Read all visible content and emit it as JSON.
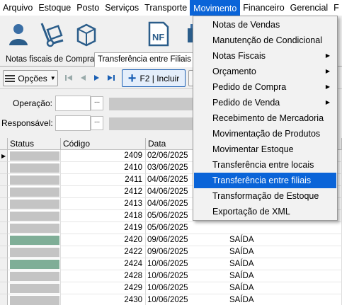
{
  "menubar": {
    "items": [
      "Arquivo",
      "Estoque",
      "Posto",
      "Serviços",
      "Transporte",
      "Movimento",
      "Financeiro",
      "Gerencial",
      "F"
    ],
    "active": "Movimento"
  },
  "tabs": [
    "Notas fiscais de Compras",
    "Transferência entre Filiais"
  ],
  "toolbar": {
    "options_label": "Opções",
    "include_label": "F2 | Incluir"
  },
  "filters": {
    "operation_label": "Operação:",
    "responsible_label": "Responsável:",
    "ellipsis": "..."
  },
  "grid": {
    "columns": [
      "Status",
      "Código",
      "Data"
    ],
    "rows": [
      {
        "code": "2409",
        "date": "02/06/2025",
        "status": "gray",
        "extra": ""
      },
      {
        "code": "2410",
        "date": "03/06/2025",
        "status": "gray",
        "extra": ""
      },
      {
        "code": "2411",
        "date": "04/06/2025",
        "status": "gray",
        "extra": ""
      },
      {
        "code": "2412",
        "date": "04/06/2025",
        "status": "gray",
        "extra": ""
      },
      {
        "code": "2413",
        "date": "04/06/2025",
        "status": "gray",
        "extra": ""
      },
      {
        "code": "2418",
        "date": "05/06/2025",
        "status": "gray",
        "extra": ""
      },
      {
        "code": "2419",
        "date": "05/06/2025",
        "status": "gray",
        "extra": ""
      },
      {
        "code": "2420",
        "date": "09/06/2025",
        "status": "green",
        "extra": "SAÍDA"
      },
      {
        "code": "2422",
        "date": "09/06/2025",
        "status": "gray",
        "extra": "SAÍDA"
      },
      {
        "code": "2424",
        "date": "10/06/2025",
        "status": "green",
        "extra": "SAÍDA"
      },
      {
        "code": "2428",
        "date": "10/06/2025",
        "status": "gray",
        "extra": "SAÍDA"
      },
      {
        "code": "2429",
        "date": "10/06/2025",
        "status": "gray",
        "extra": "SAÍDA"
      },
      {
        "code": "2430",
        "date": "10/06/2025",
        "status": "gray",
        "extra": "SAÍDA"
      }
    ]
  },
  "dropdown": {
    "items": [
      {
        "label": "Notas de Vendas",
        "submenu": false
      },
      {
        "label": "Manutenção de Condicional",
        "submenu": false
      },
      {
        "label": "Notas Fiscais",
        "submenu": true
      },
      {
        "label": "Orçamento",
        "submenu": true
      },
      {
        "label": "Pedido de Compra",
        "submenu": true
      },
      {
        "label": "Pedido de Venda",
        "submenu": true
      },
      {
        "label": "Recebimento de Mercadoria",
        "submenu": false
      },
      {
        "label": "Movimentação de Produtos",
        "submenu": false
      },
      {
        "label": "Movimentar Estoque",
        "submenu": false
      },
      {
        "label": "Transferência entre locais",
        "submenu": false
      },
      {
        "label": "Transferência entre filiais",
        "submenu": false
      },
      {
        "label": "Transformação de Estoque",
        "submenu": false
      },
      {
        "label": "Exportação de XML",
        "submenu": false
      }
    ],
    "highlighted": "Transferência entre filiais"
  },
  "colors": {
    "accent": "#0a64d8",
    "status_gray": "#c4c4c4",
    "status_green": "#7fae97",
    "icon_blue": "#2b5d8a"
  },
  "icons": [
    "user-icon",
    "hand-truck-icon",
    "box-icon",
    "invoice-nf-icon",
    "cash-register-icon"
  ]
}
